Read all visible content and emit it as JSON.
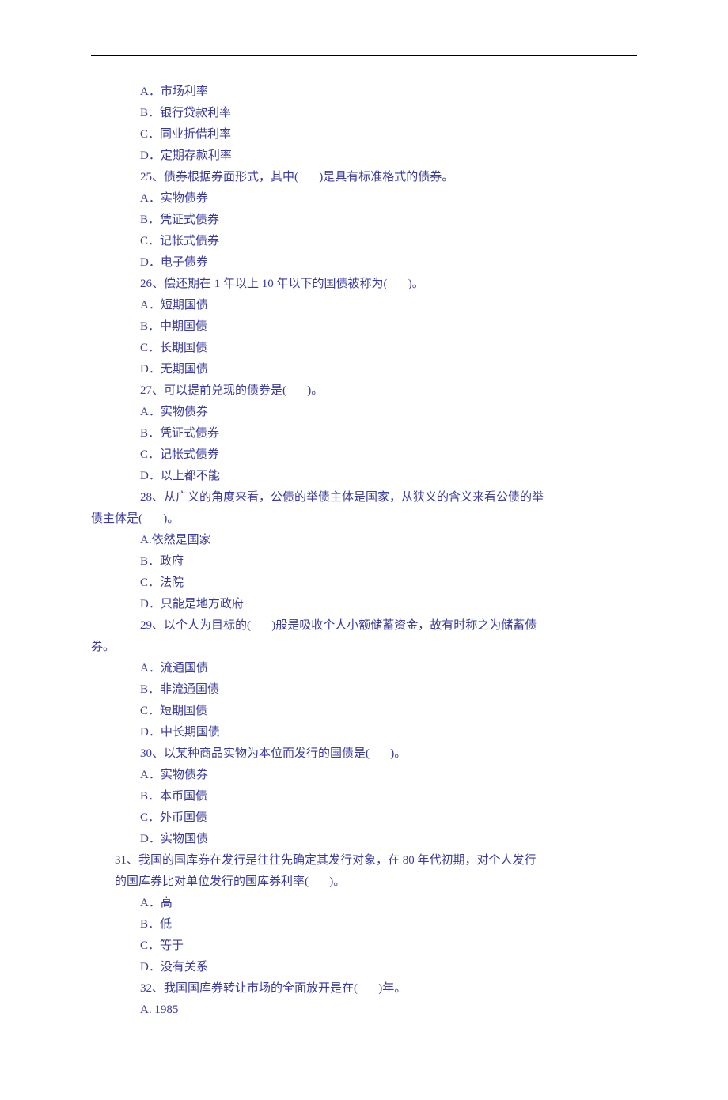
{
  "lines": [
    {
      "cls": "indent-1",
      "t": "A．市场利率"
    },
    {
      "cls": "indent-1",
      "t": "B．银行贷款利率"
    },
    {
      "cls": "indent-1",
      "t": "C．同业折借利率"
    },
    {
      "cls": "indent-1",
      "t": "D．定期存款利率"
    },
    {
      "cls": "indent-1",
      "t": "25、债券根据券面形式，其中(       )是具有标准格式的债券。"
    },
    {
      "cls": "indent-1",
      "t": "A．实物债券"
    },
    {
      "cls": "indent-1",
      "t": "B．凭证式债券"
    },
    {
      "cls": "indent-1",
      "t": "C．记帐式债券"
    },
    {
      "cls": "indent-1",
      "t": "D．电子债券"
    },
    {
      "cls": "indent-1",
      "t": "26、偿还期在 1 年以上 10 年以下的国债被称为(       )。"
    },
    {
      "cls": "indent-1",
      "t": "A．短期国债"
    },
    {
      "cls": "indent-1",
      "t": "B．中期国债"
    },
    {
      "cls": "indent-1",
      "t": "C．长期国债"
    },
    {
      "cls": "indent-1",
      "t": "D．无期国债"
    },
    {
      "cls": "indent-1",
      "t": "27、可以提前兑现的债券是(       )。"
    },
    {
      "cls": "indent-1",
      "t": "A．实物债券"
    },
    {
      "cls": "indent-1",
      "t": "B．凭证式债券"
    },
    {
      "cls": "indent-1",
      "t": "C．记帐式债券"
    },
    {
      "cls": "indent-1",
      "t": "D．以上都不能"
    },
    {
      "cls": "indent-1",
      "t": "28、从广义的角度来看，公债的举债主体是国家，从狭义的含义来看公债的举"
    },
    {
      "cls": "indent-0",
      "t": "债主体是(       )。"
    },
    {
      "cls": "indent-1",
      "t": "A.依然是国家"
    },
    {
      "cls": "indent-1",
      "t": "B．政府"
    },
    {
      "cls": "indent-1",
      "t": "C．法院"
    },
    {
      "cls": "indent-1",
      "t": "D．只能是地方政府"
    },
    {
      "cls": "indent-1",
      "t": "29、以个人为目标的(       )般是吸收个人小额储蓄资金，故有时称之为储蓄债"
    },
    {
      "cls": "indent-0",
      "t": "券。"
    },
    {
      "cls": "indent-1",
      "t": "A．流通国债"
    },
    {
      "cls": "indent-1",
      "t": "B．非流通国债"
    },
    {
      "cls": "indent-1",
      "t": "C．短期国债"
    },
    {
      "cls": "indent-1",
      "t": "D．中长期国债"
    },
    {
      "cls": "indent-1",
      "t": "30、以某种商品实物为本位而发行的国债是(       )。"
    },
    {
      "cls": "indent-1",
      "t": "A．实物债券"
    },
    {
      "cls": "indent-1",
      "t": "B．本币国债"
    },
    {
      "cls": "indent-1",
      "t": "C．外币国债"
    },
    {
      "cls": "indent-1",
      "t": "D．实物国债"
    },
    {
      "cls": "indent-q",
      "t": "31、我国的国库券在发行是往往先确定其发行对象，在 80 年代初期，对个人发行"
    },
    {
      "cls": "indent-q",
      "t": "的国库券比对单位发行的国库券利率(       )。"
    },
    {
      "cls": "indent-1",
      "t": "A．高"
    },
    {
      "cls": "indent-1",
      "t": "B．低"
    },
    {
      "cls": "indent-1",
      "t": "C．等于"
    },
    {
      "cls": "indent-1",
      "t": "D．没有关系"
    },
    {
      "cls": "indent-1",
      "t": "32、我国国库券转让市场的全面放开是在(       )年。"
    },
    {
      "cls": "indent-1",
      "t": "A. 1985"
    }
  ]
}
